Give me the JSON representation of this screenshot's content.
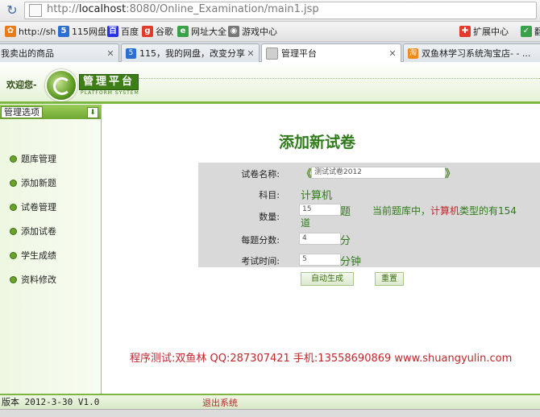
{
  "browser": {
    "url_prefix": "http://",
    "url_host": "localhost",
    "url_rest": ":8080/Online_Examination/main1.jsp",
    "favorites": [
      {
        "label": "http://sh",
        "icon": "qq-bookmark-icon",
        "color": "#e87a18"
      },
      {
        "label": "115网盘",
        "icon": "115-icon",
        "color": "#2a6fd1"
      },
      {
        "label": "百度",
        "icon": "baidu-icon",
        "color": "#2932e1"
      },
      {
        "label": "谷歌",
        "icon": "google-icon",
        "color": "#e23b2e"
      },
      {
        "label": "网址大全",
        "icon": "url-directory-icon",
        "color": "#3aa04a"
      },
      {
        "label": "游戏中心",
        "icon": "game-center-icon",
        "color": "#777777"
      },
      {
        "label": "扩展中心",
        "icon": "extension-icon",
        "color": "#e23b2e"
      },
      {
        "label": "翻",
        "icon": "translate-icon",
        "color": "#3aa04a"
      }
    ],
    "tabs": [
      {
        "label": "我卖出的商品",
        "icon": "shop-icon",
        "color": "#f08a1c"
      },
      {
        "label": "115，我的网盘，改变分享！",
        "icon": "115-icon",
        "color": "#2a6fd1"
      },
      {
        "label": "管理平台",
        "icon": "page-icon",
        "color": "#888888"
      },
      {
        "label": "双鱼林学习系统淘宝店- - ...",
        "icon": "taobao-icon",
        "color": "#f08a1c"
      }
    ]
  },
  "header": {
    "welcome": "欢迎您-",
    "platform_title": "管理平台",
    "platform_subtitle": "PLATFORM SYSTEM"
  },
  "sidebar": {
    "title": "管理选项",
    "items": [
      {
        "label": "题库管理"
      },
      {
        "label": "添加新题"
      },
      {
        "label": "试卷管理"
      },
      {
        "label": "添加试卷"
      },
      {
        "label": "学生成绩"
      },
      {
        "label": "资料修改"
      }
    ]
  },
  "form": {
    "title": "添加新试卷",
    "paper_name_label": "试卷名称:",
    "paper_name_value": "测试试卷2012",
    "subject_label": "科目:",
    "subject_value": "计算机",
    "count_label": "数量:",
    "count_value": "15",
    "count_unit": "题",
    "count_note_prefix": "当前题库中，",
    "count_note_subject": "计算机",
    "count_note_middle": "类型的有154",
    "count_note_suffix": "道",
    "score_label": "每题分数:",
    "score_value": "4",
    "score_unit": "分",
    "time_label": "考试时间:",
    "time_value": "5",
    "time_unit": "分钟",
    "generate_button": "自动生成",
    "reset_button": "重置"
  },
  "footer": {
    "credit": "程序测试:双鱼林 QQ:287307421 手机:13558690869 www.shuangyulin.com",
    "version": "版本 2012-3-30 V1.0",
    "logout": "退出系统"
  }
}
